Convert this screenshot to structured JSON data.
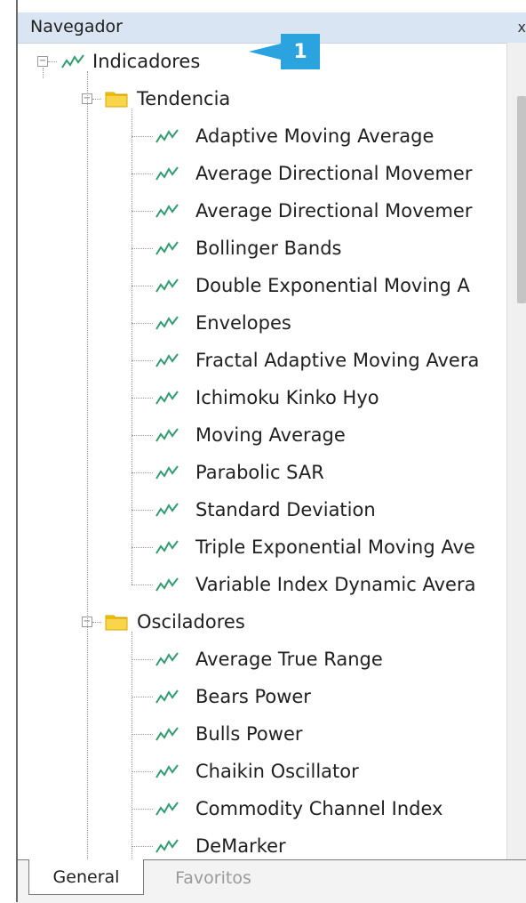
{
  "panel": {
    "title": "Navegador",
    "close_glyph": "x"
  },
  "root": {
    "label": "Indicadores",
    "icon": "indicator-icon"
  },
  "groups": [
    {
      "label": "Tendencia",
      "icon": "folder-icon",
      "items": [
        "Adaptive Moving Average",
        "Average Directional Movemer",
        "Average Directional Movemer",
        "Bollinger Bands",
        "Double Exponential Moving A",
        "Envelopes",
        "Fractal Adaptive Moving Avera",
        "Ichimoku Kinko Hyo",
        "Moving Average",
        "Parabolic SAR",
        "Standard Deviation",
        "Triple Exponential Moving Ave",
        "Variable Index Dynamic Avera"
      ]
    },
    {
      "label": "Osciladores",
      "icon": "folder-icon",
      "items": [
        "Average True Range",
        "Bears Power",
        "Bulls Power",
        "Chaikin Oscillator",
        "Commodity Channel Index",
        "DeMarker"
      ]
    }
  ],
  "tabs": [
    {
      "label": "General",
      "active": true
    },
    {
      "label": "Favoritos",
      "active": false
    }
  ],
  "annotation": {
    "number": "1"
  },
  "colors": {
    "titlebar": "#d9e5f2",
    "folder": "#f5c400",
    "indicator": "#2f9e6e",
    "badge": "#2aa3de"
  }
}
